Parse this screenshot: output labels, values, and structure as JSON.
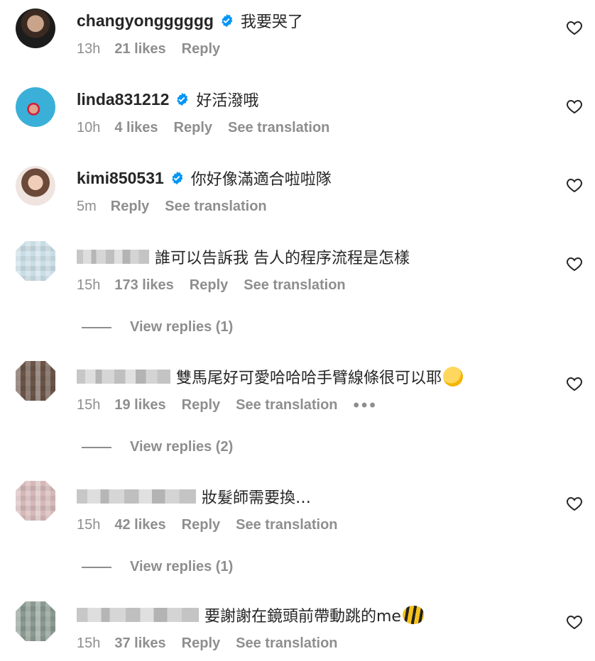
{
  "comments": [
    {
      "username": "changyongggggg",
      "verified": true,
      "text": "我要哭了",
      "time": "13h",
      "likes": "21 likes",
      "reply": "Reply",
      "translation": "",
      "replies": ""
    },
    {
      "username": "linda831212",
      "verified": true,
      "text": "好活潑哦",
      "time": "10h",
      "likes": "4 likes",
      "reply": "Reply",
      "translation": "See translation",
      "replies": ""
    },
    {
      "username": "kimi850531",
      "verified": true,
      "text": "你好像滿適合啦啦隊",
      "time": "5m",
      "likes": "",
      "reply": "Reply",
      "translation": "See translation",
      "replies": ""
    },
    {
      "username": "",
      "verified": false,
      "text": "誰可以告訴我 告人的程序流程是怎樣",
      "time": "15h",
      "likes": "173 likes",
      "reply": "Reply",
      "translation": "See translation",
      "replies": "View replies (1)"
    },
    {
      "username": "",
      "verified": false,
      "text": "雙馬尾好可愛哈哈哈手臂線條很可以耶",
      "time": "15h",
      "likes": "19 likes",
      "reply": "Reply",
      "translation": "See translation",
      "more": "•••",
      "replies": "View replies (2)"
    },
    {
      "username": "",
      "verified": false,
      "text": "妝髮師需要換…",
      "time": "15h",
      "likes": "42 likes",
      "reply": "Reply",
      "translation": "See translation",
      "replies": "View replies (1)"
    },
    {
      "username": "",
      "verified": false,
      "text": "要謝謝在鏡頭前帶動跳的me",
      "time": "15h",
      "likes": "37 likes",
      "reply": "Reply",
      "translation": "See translation",
      "replies": ""
    }
  ],
  "icons": {
    "verified": "verified-badge-icon",
    "like": "heart-icon",
    "emoji_rofl": "rolling-on-floor-laughing-emoji",
    "emoji_bee": "honeybee-emoji"
  },
  "colors": {
    "text": "#262626",
    "secondary": "#8e8e8e",
    "verified": "#0095f6"
  }
}
